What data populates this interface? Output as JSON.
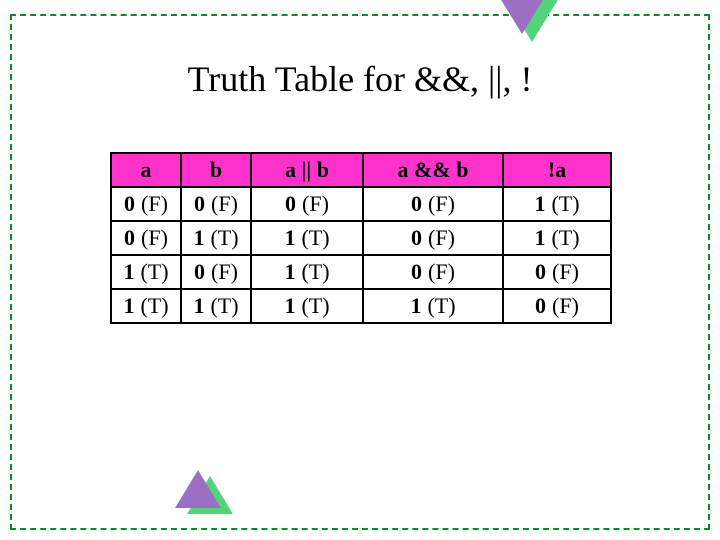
{
  "title": "Truth Table for &&, ||, !",
  "headers": {
    "a": "a",
    "b": "b",
    "or": "a || b",
    "and": "a && b",
    "not": "!a"
  },
  "rows": [
    {
      "a": {
        "v": "0",
        "p": "(F)"
      },
      "b": {
        "v": "0",
        "p": "(F)"
      },
      "or": {
        "v": "0",
        "p": "(F)"
      },
      "and": {
        "v": "0",
        "p": "(F)"
      },
      "not": {
        "v": "1",
        "p": "(T)"
      }
    },
    {
      "a": {
        "v": "0",
        "p": "(F)"
      },
      "b": {
        "v": "1",
        "p": "(T)"
      },
      "or": {
        "v": "1",
        "p": "(T)"
      },
      "and": {
        "v": "0",
        "p": "(F)"
      },
      "not": {
        "v": "1",
        "p": "(T)"
      }
    },
    {
      "a": {
        "v": "1",
        "p": "(T)"
      },
      "b": {
        "v": "0",
        "p": "(F)"
      },
      "or": {
        "v": "1",
        "p": "(T)"
      },
      "and": {
        "v": "0",
        "p": "(F)"
      },
      "not": {
        "v": "0",
        "p": "(F)"
      }
    },
    {
      "a": {
        "v": "1",
        "p": "(T)"
      },
      "b": {
        "v": "1",
        "p": "(T)"
      },
      "or": {
        "v": "1",
        "p": "(T)"
      },
      "and": {
        "v": "1",
        "p": "(T)"
      },
      "not": {
        "v": "0",
        "p": "(F)"
      }
    }
  ],
  "colors": {
    "border_dashed": "#0a8a2a",
    "header_bg": "#ff33cc",
    "triangle_main": "#9a6fc4",
    "triangle_shadow": "#54d47a"
  },
  "chart_data": {
    "type": "table",
    "title": "Truth Table for &&, ||, !",
    "columns": [
      "a",
      "b",
      "a || b",
      "a && b",
      "!a"
    ],
    "rows": [
      [
        "0 (F)",
        "0 (F)",
        "0 (F)",
        "0 (F)",
        "1 (T)"
      ],
      [
        "0 (F)",
        "1 (T)",
        "1 (T)",
        "0 (F)",
        "1 (T)"
      ],
      [
        "1 (T)",
        "0 (F)",
        "1 (T)",
        "0 (F)",
        "0 (F)"
      ],
      [
        "1 (T)",
        "1 (T)",
        "1 (T)",
        "1 (T)",
        "0 (F)"
      ]
    ]
  }
}
